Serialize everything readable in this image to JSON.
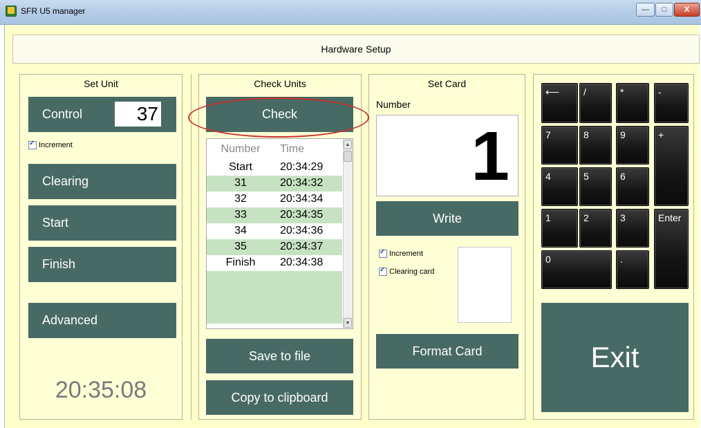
{
  "window": {
    "title": "SFR U5 manager",
    "minimize_glyph": "—",
    "maximize_glyph": "□",
    "close_glyph": "X"
  },
  "header": {
    "title": "Hardware Setup"
  },
  "set_unit": {
    "title": "Set Unit",
    "control_label": "Control",
    "control_value": "37",
    "increment_label": "Increment",
    "increment_checked": true,
    "clearing_label": "Clearing",
    "start_label": "Start",
    "finish_label": "Finish",
    "advanced_label": "Advanced",
    "clock": "20:35:08"
  },
  "check_units": {
    "title": "Check Units",
    "check_label": "Check",
    "columns": [
      "Number",
      "Time"
    ],
    "rows": [
      {
        "number": "Start",
        "time": "20:34:29"
      },
      {
        "number": "31",
        "time": "20:34:32"
      },
      {
        "number": "32",
        "time": "20:34:34"
      },
      {
        "number": "33",
        "time": "20:34:35"
      },
      {
        "number": "34",
        "time": "20:34:36"
      },
      {
        "number": "35",
        "time": "20:34:37"
      },
      {
        "number": "Finish",
        "time": "20:34:38"
      },
      {
        "number": "",
        "time": ""
      }
    ],
    "save_label": "Save to file",
    "copy_label": "Copy to clipboard"
  },
  "set_card": {
    "title": "Set Card",
    "number_label": "Number",
    "number_value": "1",
    "write_label": "Write",
    "increment_label": "Increment",
    "increment_checked": true,
    "clearing_card_label": "Clearing card",
    "clearing_card_checked": true,
    "format_label": "Format Card"
  },
  "keypad": {
    "keys": {
      "back": "⟵",
      "divide": "/",
      "multiply": "*",
      "minus": "-",
      "k7": "7",
      "k8": "8",
      "k9": "9",
      "plus": "+",
      "k4": "4",
      "k5": "5",
      "k6": "6",
      "k1": "1",
      "k2": "2",
      "k3": "3",
      "enter": "Enter",
      "k0": "0",
      "dot": "."
    },
    "exit_label": "Exit"
  },
  "colors": {
    "button_bg": "#486a65",
    "panel_bg": "#ffffd6",
    "list_alt_row": "#c7e2c3",
    "annotation": "#c9302c"
  }
}
